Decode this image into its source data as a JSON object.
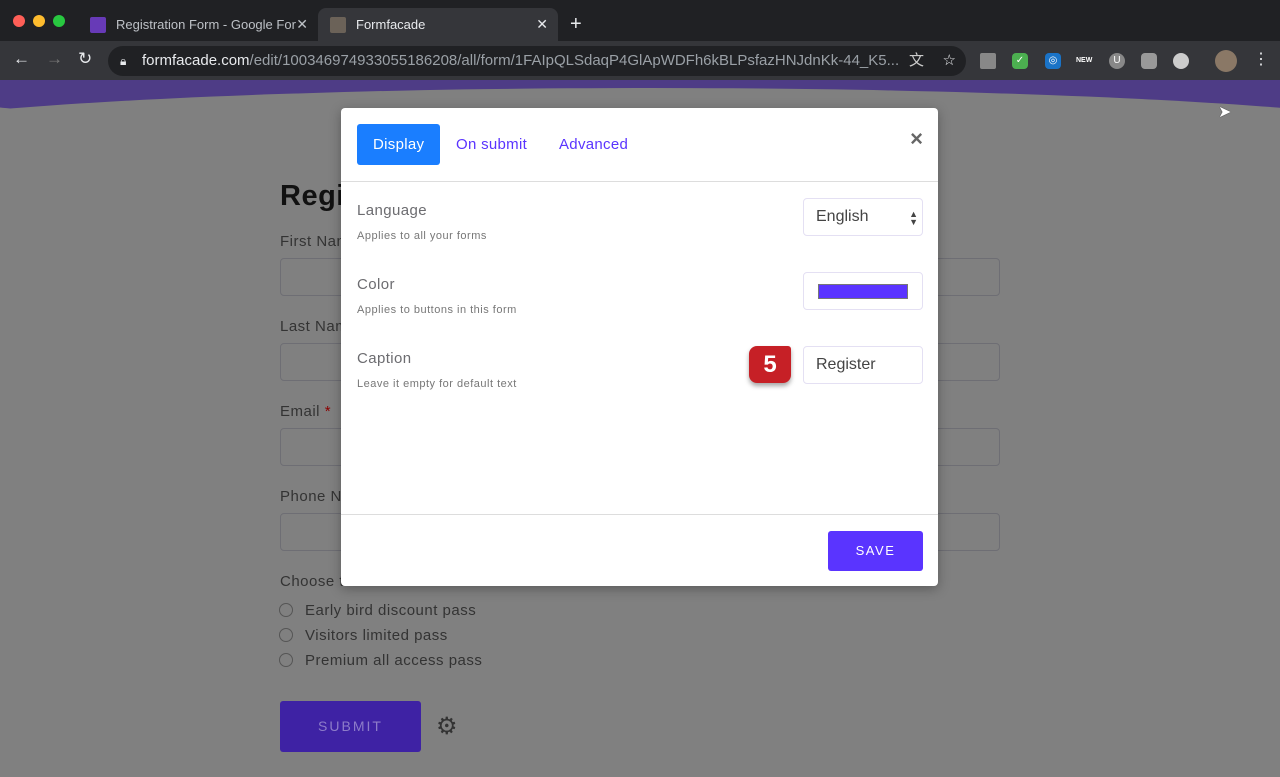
{
  "browser": {
    "tabs": [
      {
        "title": "Registration Form - Google For",
        "icon": "google-forms-icon"
      },
      {
        "title": "Formfacade",
        "icon": "profile-favicon"
      }
    ],
    "url_host": "formfacade.com",
    "url_path": "/edit/100346974933055186208/all/form/1FAIpQLSdaqP4GlApWDFh6kBLPsfazHNJdnKk-44_K5...",
    "extensions": [
      "google-drive-icon",
      "mail-icon",
      "compass-icon",
      "new-icon",
      "u-icon",
      "chat-icon",
      "circle-icon"
    ],
    "new_badge": "NEW"
  },
  "form": {
    "title": "Regi",
    "fields": [
      "First Nam",
      "Last Nam",
      "Email",
      "Phone N"
    ],
    "required_mark": "*",
    "question": "Choose t",
    "options": [
      "Early bird discount pass",
      "Visitors limited pass",
      "Premium all access pass"
    ],
    "submit": "SUBMIT"
  },
  "modal": {
    "tabs": [
      "Display",
      "On submit",
      "Advanced"
    ],
    "close": "×",
    "language": {
      "label": "Language",
      "help": "Applies to all your forms",
      "value": "English"
    },
    "color": {
      "label": "Color",
      "help": "Applies to buttons in this form",
      "value": "#5a34ff"
    },
    "caption": {
      "label": "Caption",
      "help": "Leave it empty for default text",
      "value": "Register"
    },
    "step_badge": "5",
    "save": "SAVE"
  }
}
